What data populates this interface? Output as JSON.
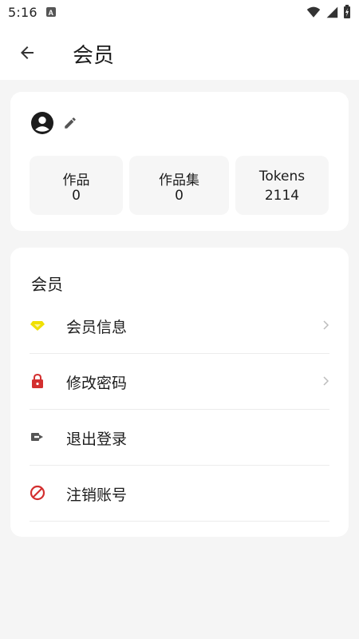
{
  "status_bar": {
    "time": "5:16",
    "icons": [
      "notification-a-icon",
      "wifi-icon",
      "signal-icon",
      "battery-charging-icon"
    ]
  },
  "app_bar": {
    "back_icon": "arrow-back-icon",
    "title": "会员"
  },
  "profile": {
    "avatar_icon": "account-circle-icon",
    "edit_icon": "pencil-icon",
    "stats": [
      {
        "label": "作品",
        "value": "0"
      },
      {
        "label": "作品集",
        "value": "0"
      },
      {
        "label": "Tokens",
        "value": "2114"
      }
    ]
  },
  "member_section": {
    "title": "会员",
    "items": [
      {
        "label": "会员信息",
        "icon": "diamond-icon",
        "icon_color": "#f0e000",
        "has_chevron": true
      },
      {
        "label": "修改密码",
        "icon": "lock-icon",
        "icon_color": "#d32f2f",
        "has_chevron": true
      },
      {
        "label": "退出登录",
        "icon": "logout-icon",
        "icon_color": "#555555",
        "has_chevron": false
      },
      {
        "label": "注销账号",
        "icon": "block-icon",
        "icon_color": "#d32f2f",
        "has_chevron": false
      }
    ]
  },
  "colors": {
    "background": "#f5f5f5",
    "card": "#ffffff",
    "stat_tile": "#f6f6f6",
    "text": "#1c1c1c"
  }
}
